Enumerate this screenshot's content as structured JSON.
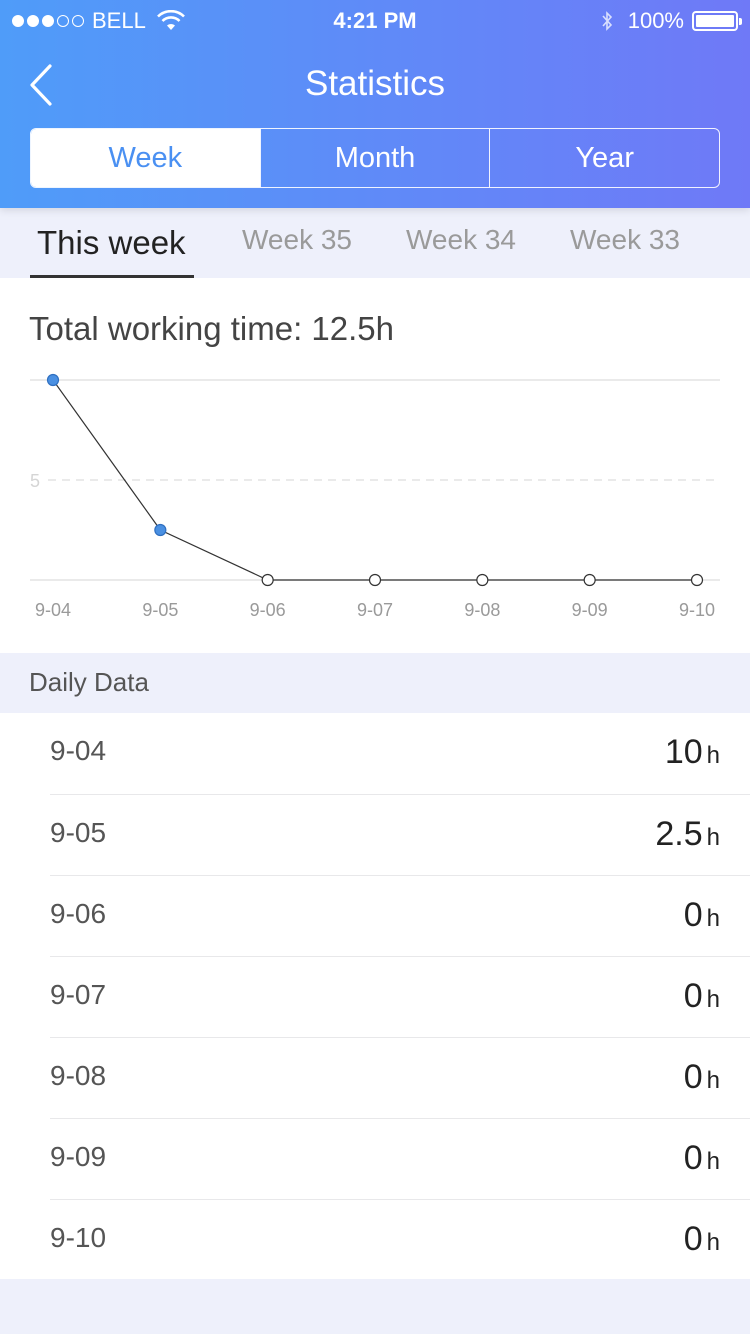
{
  "status_bar": {
    "carrier": "BELL",
    "signal_bars_filled": 3,
    "signal_bars_total": 5,
    "time": "4:21 PM",
    "battery_percent": "100%"
  },
  "nav": {
    "title": "Statistics",
    "back_icon": "chevron-left-icon"
  },
  "period_tabs": [
    {
      "label": "Week",
      "active": true
    },
    {
      "label": "Month",
      "active": false
    },
    {
      "label": "Year",
      "active": false
    }
  ],
  "week_tabs": [
    {
      "label": "This week",
      "active": true
    },
    {
      "label": "Week 35",
      "active": false
    },
    {
      "label": "Week 34",
      "active": false
    },
    {
      "label": "Week 33",
      "active": false
    }
  ],
  "summary": {
    "total_working_time": "Total working time: 12.5h"
  },
  "chart_data": {
    "type": "line",
    "x": [
      "9-04",
      "9-05",
      "9-06",
      "9-07",
      "9-08",
      "9-09",
      "9-10"
    ],
    "series": [
      {
        "values": [
          10,
          2.5,
          0,
          0,
          0,
          0,
          0
        ]
      }
    ],
    "yticks": [
      "5"
    ],
    "ylim": [
      0,
      10
    ],
    "grid": true,
    "colors": {
      "positive_point": "#4a90e2",
      "line": "#333333",
      "grid": "#e3e3e3"
    }
  },
  "daily_data": {
    "heading": "Daily Data",
    "unit": "h",
    "rows": [
      {
        "date": "9-04",
        "value": "10"
      },
      {
        "date": "9-05",
        "value": "2.5"
      },
      {
        "date": "9-06",
        "value": "0"
      },
      {
        "date": "9-07",
        "value": "0"
      },
      {
        "date": "9-08",
        "value": "0"
      },
      {
        "date": "9-09",
        "value": "0"
      },
      {
        "date": "9-10",
        "value": "0"
      }
    ]
  },
  "colors": {
    "header_gradient_start": "#4f9cf9",
    "header_gradient_end": "#6f79f7",
    "accent": "#4a90f2",
    "background": "#eef0fb"
  }
}
